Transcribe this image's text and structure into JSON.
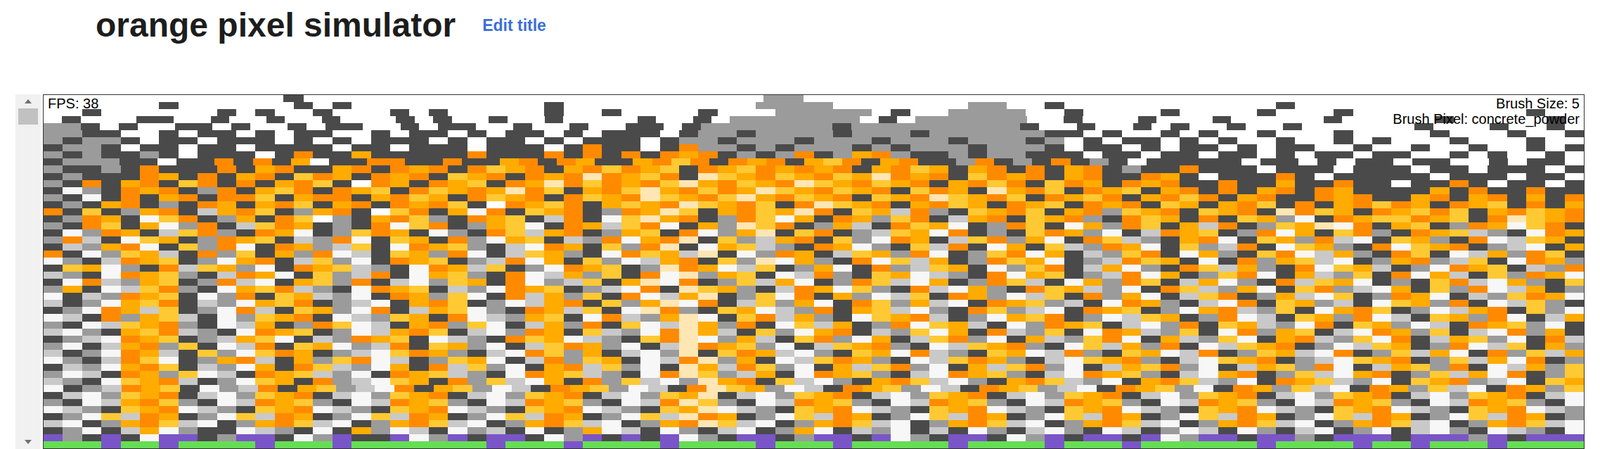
{
  "page": {
    "title": "orange pixel simulator",
    "edit_link": "Edit title"
  },
  "scrollbar": {
    "level": 0.05
  },
  "canvas": {
    "fps": "FPS: 38",
    "brush_size": "Brush Size: 5",
    "brush_pixel": "Brush Pixel: concrete_powder",
    "palette": [
      {
        "key": ".",
        "color": "#ffffff"
      },
      {
        "key": "w",
        "color": "#f7f7f7"
      },
      {
        "key": "d",
        "color": "#4a4a4a"
      },
      {
        "key": "g",
        "color": "#9b9b9b"
      },
      {
        "key": "l",
        "color": "#c9c9c9"
      },
      {
        "key": "o",
        "color": "#ff8a00"
      },
      {
        "key": "a",
        "color": "#ffab00"
      },
      {
        "key": "y",
        "color": "#ffc933"
      },
      {
        "key": "p",
        "color": "#ffe6b3"
      },
      {
        "key": "u",
        "color": "#7a55c8"
      },
      {
        "key": "G",
        "color": "#66dd55"
      }
    ],
    "rows": [
      "............d.......................gg.......................................",
      "......d......d.d..........d..........gggg.......gg..d...........d...............",
      "..d......d.d..d...d.d.....d..d....d...ggggg.d..gggg..d....d....d...d.........d..",
      ".d...dd..d..d..d...d.d..d..d....d..d.ggggggg.d.gggggg..d...d...d.....d.....d.....d.",
      "ggd.d..dd.d..d.dd..d.dd..d..d..dd.dgggggggdgggggggggd..d..d.d..d..d......d...d..d.",
      "ggdd..d.dd.d.dd..d.dd.d.dd.d.ddd.dggdggggdgggdggggggdd.d..d.d..d...d....d...d..d",
      "gdggd.dd.ddd.d.d.ddd.d.dd.d.ddd.dggdgggdgggdgggdgggdg.d.dd.d.d..d..d.d...d...d..",
      "dggd.dd.dd.dddd.dd.ddd.ddd.dodd.doggdgdgggdgdgggdgggd.dd.d.dd.d.dd..d..d..d..d.d",
      "gdgddgd.ddd.doddadddddodddodododoaodgdgodgaogddgdggddd.dd.dd.dd.d.dd.dd..d.d..d.",
      "dgggdd.ddododa ddooddoddaodoaddaoyodoaodayodaoddgodgdodgd.ddddd.dd.d.dd.dd..d.dd.",
      "gddgdodddodaoddaodoaodoyaodaoyoaydoayoaoaodaoyadaododaodgddoddd.ddd.ddd.dd.ddd.d",
      "dgdddoadodaodyoadoaodyaodoaopoayodpyaoyaoyapoaodyoaodaoddoad.dddod.ddddd.ddd.dd.",
      "gdodaodyododaoyd.oadoaydoapoyoaoypaoyaopyaoyaodaoyodyoadoaoddoddaddodd.ddod.dd.d",
      "dwgdoaodgodayodoaydoyaoapoydaoypaoyoapyaoyaodyoadpaoydoaydaododaodoaddddadoddodd",
      "gdwdodaodooydaoodaoyadoyaodoyaopyaoypaoyaodyaopyaoydoayodaoyodaoddoaoddaodaodado",
      "dgdaodgdoadaoydaodoaoyd.oayodayaopyaoydopyaodaoyadoaydoaodyadaoydodaoyoadoaydoda",
      "odydgaodlaoydgaod.yodawodyaodgoapydaoyapodyalogdyaoydaogyaodyaodpoyadoayoydaoyao",
      "dgoadwyodgadoy.gdaoygdoaydlodwypaodgoywadoagyodlaodyaogdoyadodyagwdoayyoaydopyao",
      "gdoydawgodlyoadgdowyodgaywdoalyowdagpyodgaldoyawdgoydwagoydalodgyapwodaydgoawyod",
      "dwgoadlyogdoawdgyoadwgdoylaodgaydowgapdyodglyawodgdyoagwdloaydgowadyogdoaylgdwoa",
      "goldwyadgoaydlgowdyadogwaydlgowaopdyglaodygwoadlyogawdoylgdaowdyagolwdyagdowlyad",
      "dlgaowdygowdoaglydwoaygdlwoadygopdwaylgdoawgdylodwadylgoawdyglodwyagdowyaodglwda",
      "odwgyaldogydagowldyagowdlyagdwoyalpdwgoadlyagowdgyowadlgyodwagdyowlagdoydwlagoyd",
      "wgdloaydgwaodlygwdoaydglowadygwlaodygpwagdowyladgoyawdgloyadwdogaylwdgaoglydwoag",
      "dyawgdolyagwdoaylgdwoalydgwoaydgpoawlydgawdoglyadwgyodlawgdoylagdowyaldgwoaydlgo",
      "lgdwoaygdloawdyglodwaygdowlagydowpgaydwlogdyawlgdowaydglowadgyowdalgydowaldygoaw",
      "dwolgaydgolwdaygodlwgyadowglydapwodgylawdgoylwadgoyldwagoydlawgdolyawdgdyolwagdy",
      "gadwlyogdwayolgdwoaydlgwoaydglwodpyagdloawygdolwagdoyalgwdoylgawdyoglwadygowladg",
      "wdlgoaydwgodyalgwdoagywdolagydowlapdgywodagwlydoagwlydogawdlyodgalwydgoawdlgyoaw",
      "ldgwayodlgwayodglwdaoydgwlaodygapwodlygawdoygalwdoaygldwoagdlwodyagldwyagodwlygd",
      "dgwoalydgwoldyagwodlaywgdoalydwpogdyawlgodaylwgdoyglwdoaydgwaolgydwaoydgwlaodygw",
      "wldogayldwgyaodwlgyadowlgaydwolgapwdyolagdwyaoldgwayodgwlyadgowldyagowldyagowdla",
      "gdwlyaogdwladgoywldaogywdlagodywlpagodwyladgowyaldwgoaydlwgodyalgwodyagwldoaygwd",
      "lwgdayolgdwoaydgwlaoydlwgoadylgwopaldygwaodlgywadolgydwoalgydwogaydlwoagydlwogad",
      "dglwoaydglaywdlgoaydwlgdoyawlgdyopwgaldyogwadlyogwdalgyowdalgywdaolgywodlaygwdol",
      "gwdlaogydwlodyawglodyagwdlyoagwdlpoaygwdlyaogdwlyaogdwylagodwlyaodgwlyadgowlydag",
      "ldgwoaldygwyoadglwyoagdlwoygadlwgpdyoalwgdyawolgdyawlogdyawlodgyalwodgylawdogyla",
      "wgdloywdgaoldagyowldgyawdlogyadwlopgadwlyoagdwlyoagdlwyaogdlwyaodglwyaodgylawodg",
      "dlgwaoydlgwadoylgwadolygwdaolygwdpaloygwdalyogwdalyogwdlayogwdlaygowdlaygodwlagy",
      "gwldoagywldoaylgwdoaylgdwoaylgdwopygladwoaygdlwoaygdlwoaygdlwaodgylwaodgylawodgy",
      "lgdwyaoldgwyadoglwyadogylwadogylwgpaodylwgdaoylwgdaoylgwdaoylgwdoaylgwdyaoglwdya",
      "wdgloaydwglodayglwodaygwldoaygwldopyagwldoaygwldoayglwdoaygwdoagylwdoagylwdoagy",
      "dlwgyaodlwgyaodlwgyaodlwgyaodlwgyapdlwgyaodlwgyaodlwgyaodlwgyaodlwgyaodlwgyaodlw",
      "gdwlaoygdwloaygdwloaygdwloaygdwlopygdwloaygdwloaygdwloaygdwloaygdwloaygdwloaygdw",
      "wlgdyaowlgdyaowlgdyaowlgdyaowlgdyapwlgdyaowlgdyaowlgdyaowlgdyaowlgdyaowlgdyaowlg",
      "dgwyloadgwyloadgwyloadgwyloadgwylpoadgwyloadgwyloadgwyloadgwyloadgwyloadgwyloadg",
      "lwdgaoylwdgaoylwdgaoylwdgaoylwdgaopylwdgaoylwdgaoylwdgaoylwdgaoylwdgaoylwdgaoylw",
      "dgwdlawgddwlgdwdagwldwgldwdgawldwgdlwdgawdlgwdldwgdlwgdwldgwldwgdlwdgwdlwgdwlgdw",
      "ugdudwuudguudwgudduwguduudwgududuwgduudguuduwgduudwguduuduwguuduugduuuduuuguduuu",
      "GGGuGGuGGGGuGGGuGGGGGGGuGGGuGGGGuGGGGuGGGuGGGGGuGGGGuGGGuGGGGGGuGGGGuGGuGGGuGGGG"
    ]
  }
}
